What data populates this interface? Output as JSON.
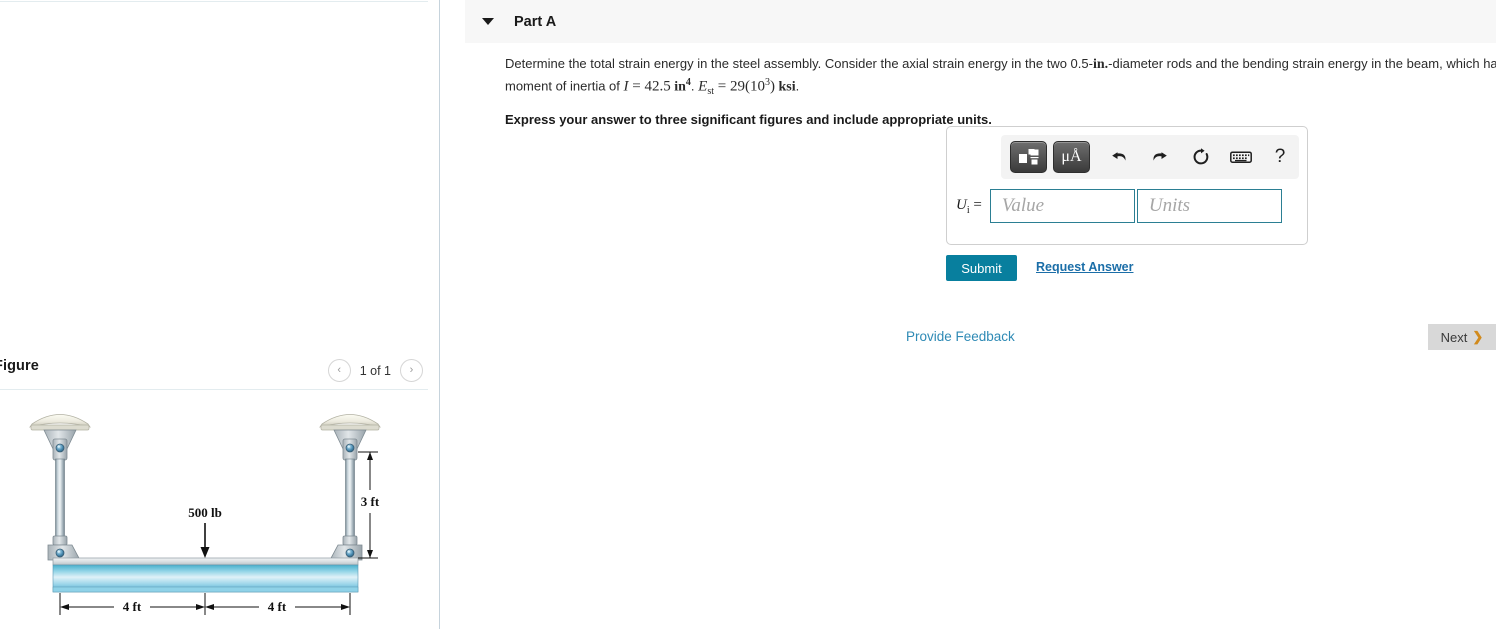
{
  "part": {
    "title": "Part A",
    "caret_icon": "triangle-down-icon"
  },
  "question": {
    "text_1": "Determine the total strain energy in the steel assembly. Consider the axial strain energy in the two 0.5-",
    "in_1": "in.",
    "text_2": "-diameter rods and the bending strain energy in the beam, which has a moment of inertia of ",
    "math_I": "I",
    "math_eq1": " = ",
    "math_val1": "42.5",
    "math_in": " in",
    "math_in_sup": "4",
    "math_period": ". ",
    "math_E": "E",
    "math_E_sub": "st",
    "math_eq2": " = ",
    "math_val2": "29(10",
    "math_val2_sup": "3",
    "math_val2_end": ")",
    "math_ksi": " ksi",
    "math_end": ".",
    "instruction": "Express your answer to three significant figures and include appropriate units."
  },
  "answer": {
    "label": "Uᵢ =",
    "label_symbol": "U",
    "label_sub": "i",
    "label_eq": "=",
    "value_placeholder": "Value",
    "units_placeholder": "Units",
    "value_current": "",
    "units_current": "",
    "toolbar": {
      "template_icon": "math-template-icon",
      "units_label": "μÅ",
      "units_icon": "units-symbol-icon",
      "undo_icon": "undo-arrow-icon",
      "undo_glyph": "↶",
      "redo_icon": "redo-arrow-icon",
      "redo_glyph": "↷",
      "reset_icon": "reset-circular-arrow-icon",
      "reset_glyph": "⟳",
      "keyboard_icon": "keyboard-icon",
      "help_icon": "help-question-icon",
      "help_glyph": "?"
    }
  },
  "actions": {
    "submit_label": "Submit",
    "request_answer_label": "Request Answer",
    "provide_feedback_label": "Provide Feedback",
    "next_label": "Next",
    "next_chevron": "❯"
  },
  "figure": {
    "title": "Figure",
    "counter": "1 of 1",
    "prev_icon": "chevron-left-icon",
    "prev_glyph": "‹",
    "next_icon": "chevron-right-icon",
    "next_glyph": "›",
    "diagram": {
      "load_label": "500 lb",
      "height_label": "3 ft",
      "span_left_label": "4 ft",
      "span_right_label": "4 ft"
    }
  },
  "colors": {
    "accent_teal": "#087f9e",
    "link_blue": "#1b6ea8",
    "feedback_blue": "#2e8ab5",
    "input_border": "#2b7f93",
    "header_bg": "#f7f7f7",
    "next_bg": "#d8d8d8",
    "next_chevron": "#d18a1c",
    "beam_top": "#4fb3cd",
    "beam_mid": "#dff1f7",
    "beam_bottom": "#3f9fc6"
  }
}
